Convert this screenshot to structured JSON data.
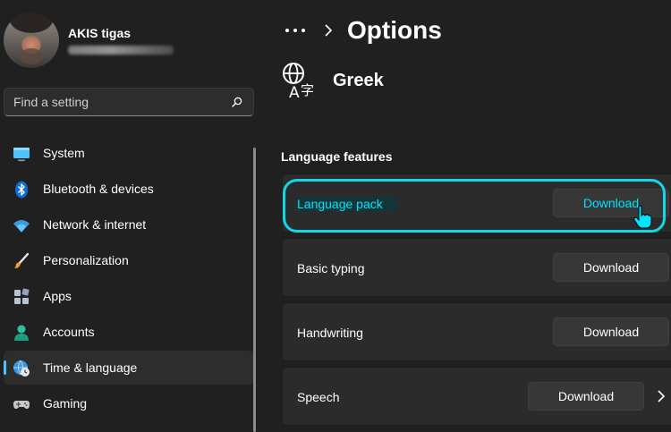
{
  "user": {
    "name": "AKIS tigas"
  },
  "search": {
    "placeholder": "Find a setting"
  },
  "nav": [
    {
      "label": "System",
      "icon": "monitor-icon",
      "selected": false
    },
    {
      "label": "Bluetooth & devices",
      "icon": "bluetooth-icon",
      "selected": false
    },
    {
      "label": "Network & internet",
      "icon": "wifi-icon",
      "selected": false
    },
    {
      "label": "Personalization",
      "icon": "paintbrush-icon",
      "selected": false
    },
    {
      "label": "Apps",
      "icon": "apps-icon",
      "selected": false
    },
    {
      "label": "Accounts",
      "icon": "person-icon",
      "selected": false
    },
    {
      "label": "Time & language",
      "icon": "globe-clock-icon",
      "selected": true
    },
    {
      "label": "Gaming",
      "icon": "gamepad-icon",
      "selected": false
    }
  ],
  "breadcrumb": {
    "title": "Options"
  },
  "language": {
    "name": "Greek",
    "icon": "language-icon"
  },
  "section": {
    "title": "Language features"
  },
  "features": [
    {
      "label": "Language pack",
      "button": "Download",
      "highlighted": true
    },
    {
      "label": "Basic typing",
      "button": "Download",
      "highlighted": false
    },
    {
      "label": "Handwriting",
      "button": "Download",
      "highlighted": false
    },
    {
      "label": "Speech",
      "button": "Download",
      "highlighted": false
    }
  ],
  "colors": {
    "accent": "#4cc2ff",
    "highlight": "#00e5ff",
    "background": "#202020",
    "card": "#2b2b2b"
  }
}
